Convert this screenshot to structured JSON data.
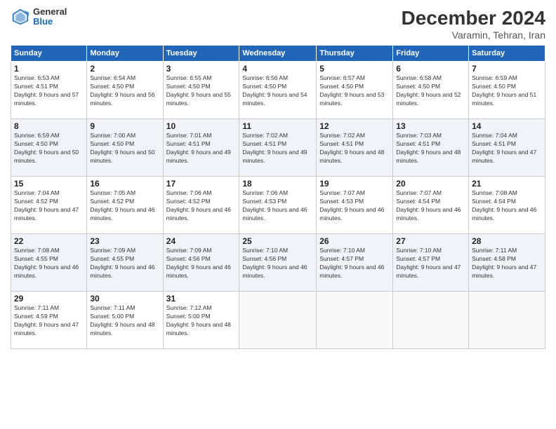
{
  "header": {
    "logo_general": "General",
    "logo_blue": "Blue",
    "month_title": "December 2024",
    "location": "Varamin, Tehran, Iran"
  },
  "days_of_week": [
    "Sunday",
    "Monday",
    "Tuesday",
    "Wednesday",
    "Thursday",
    "Friday",
    "Saturday"
  ],
  "weeks": [
    [
      {
        "day": "1",
        "sunrise": "6:53 AM",
        "sunset": "4:51 PM",
        "daylight": "9 hours and 57 minutes."
      },
      {
        "day": "2",
        "sunrise": "6:54 AM",
        "sunset": "4:50 PM",
        "daylight": "9 hours and 56 minutes."
      },
      {
        "day": "3",
        "sunrise": "6:55 AM",
        "sunset": "4:50 PM",
        "daylight": "9 hours and 55 minutes."
      },
      {
        "day": "4",
        "sunrise": "6:56 AM",
        "sunset": "4:50 PM",
        "daylight": "9 hours and 54 minutes."
      },
      {
        "day": "5",
        "sunrise": "6:57 AM",
        "sunset": "4:50 PM",
        "daylight": "9 hours and 53 minutes."
      },
      {
        "day": "6",
        "sunrise": "6:58 AM",
        "sunset": "4:50 PM",
        "daylight": "9 hours and 52 minutes."
      },
      {
        "day": "7",
        "sunrise": "6:59 AM",
        "sunset": "4:50 PM",
        "daylight": "9 hours and 51 minutes."
      }
    ],
    [
      {
        "day": "8",
        "sunrise": "6:59 AM",
        "sunset": "4:50 PM",
        "daylight": "9 hours and 50 minutes."
      },
      {
        "day": "9",
        "sunrise": "7:00 AM",
        "sunset": "4:50 PM",
        "daylight": "9 hours and 50 minutes."
      },
      {
        "day": "10",
        "sunrise": "7:01 AM",
        "sunset": "4:51 PM",
        "daylight": "9 hours and 49 minutes."
      },
      {
        "day": "11",
        "sunrise": "7:02 AM",
        "sunset": "4:51 PM",
        "daylight": "9 hours and 49 minutes."
      },
      {
        "day": "12",
        "sunrise": "7:02 AM",
        "sunset": "4:51 PM",
        "daylight": "9 hours and 48 minutes."
      },
      {
        "day": "13",
        "sunrise": "7:03 AM",
        "sunset": "4:51 PM",
        "daylight": "9 hours and 48 minutes."
      },
      {
        "day": "14",
        "sunrise": "7:04 AM",
        "sunset": "4:51 PM",
        "daylight": "9 hours and 47 minutes."
      }
    ],
    [
      {
        "day": "15",
        "sunrise": "7:04 AM",
        "sunset": "4:52 PM",
        "daylight": "9 hours and 47 minutes."
      },
      {
        "day": "16",
        "sunrise": "7:05 AM",
        "sunset": "4:52 PM",
        "daylight": "9 hours and 46 minutes."
      },
      {
        "day": "17",
        "sunrise": "7:06 AM",
        "sunset": "4:52 PM",
        "daylight": "9 hours and 46 minutes."
      },
      {
        "day": "18",
        "sunrise": "7:06 AM",
        "sunset": "4:53 PM",
        "daylight": "9 hours and 46 minutes."
      },
      {
        "day": "19",
        "sunrise": "7:07 AM",
        "sunset": "4:53 PM",
        "daylight": "9 hours and 46 minutes."
      },
      {
        "day": "20",
        "sunrise": "7:07 AM",
        "sunset": "4:54 PM",
        "daylight": "9 hours and 46 minutes."
      },
      {
        "day": "21",
        "sunrise": "7:08 AM",
        "sunset": "4:54 PM",
        "daylight": "9 hours and 46 minutes."
      }
    ],
    [
      {
        "day": "22",
        "sunrise": "7:08 AM",
        "sunset": "4:55 PM",
        "daylight": "9 hours and 46 minutes."
      },
      {
        "day": "23",
        "sunrise": "7:09 AM",
        "sunset": "4:55 PM",
        "daylight": "9 hours and 46 minutes."
      },
      {
        "day": "24",
        "sunrise": "7:09 AM",
        "sunset": "4:56 PM",
        "daylight": "9 hours and 46 minutes."
      },
      {
        "day": "25",
        "sunrise": "7:10 AM",
        "sunset": "4:56 PM",
        "daylight": "9 hours and 46 minutes."
      },
      {
        "day": "26",
        "sunrise": "7:10 AM",
        "sunset": "4:57 PM",
        "daylight": "9 hours and 46 minutes."
      },
      {
        "day": "27",
        "sunrise": "7:10 AM",
        "sunset": "4:57 PM",
        "daylight": "9 hours and 47 minutes."
      },
      {
        "day": "28",
        "sunrise": "7:11 AM",
        "sunset": "4:58 PM",
        "daylight": "9 hours and 47 minutes."
      }
    ],
    [
      {
        "day": "29",
        "sunrise": "7:11 AM",
        "sunset": "4:59 PM",
        "daylight": "9 hours and 47 minutes."
      },
      {
        "day": "30",
        "sunrise": "7:11 AM",
        "sunset": "5:00 PM",
        "daylight": "9 hours and 48 minutes."
      },
      {
        "day": "31",
        "sunrise": "7:12 AM",
        "sunset": "5:00 PM",
        "daylight": "9 hours and 48 minutes."
      },
      null,
      null,
      null,
      null
    ]
  ]
}
